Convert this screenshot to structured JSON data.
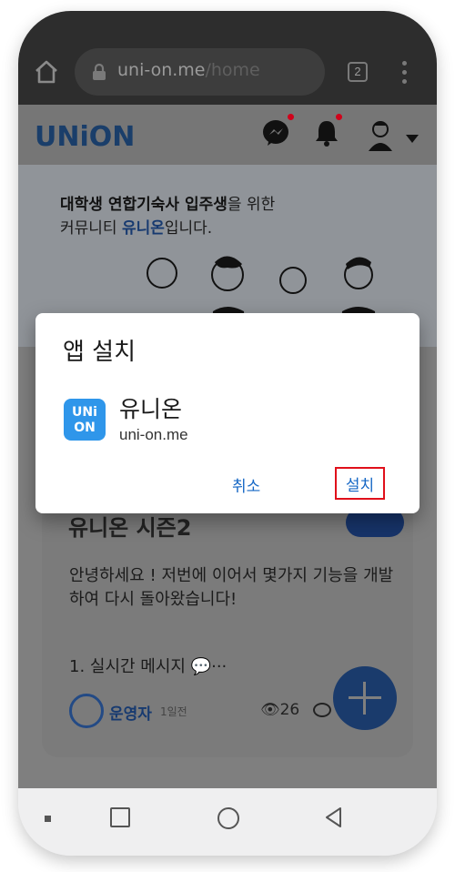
{
  "browser": {
    "url_host": "uni-on.me",
    "url_path": "/home",
    "tab_count": "2"
  },
  "site": {
    "logo": "UNiON",
    "hero_line1_bold": "대학생 연합기숙사 입주생",
    "hero_line1_rest": "을 위한",
    "hero_line2_pre": "커뮤니티 ",
    "hero_line2_brand": "유니온",
    "hero_line2_post": "입니다."
  },
  "post": {
    "title": "유니온 시즌2",
    "body": "안녕하세요 ! 저번에 이어서 몇가지 기능을 개발하여 다시 돌아왔습니다!",
    "list_item": "1. 실시간 메시지 💬···",
    "author": "운영자",
    "time": "1일전",
    "views": "26"
  },
  "dialog": {
    "title": "앱 설치",
    "app_icon_line1": "UNi",
    "app_icon_line2": "ON",
    "app_name": "유니온",
    "app_host": "uni-on.me",
    "cancel_label": "취소",
    "install_label": "설치"
  },
  "colors": {
    "accent": "#1567c5",
    "brand": "#173a70",
    "highlight_border": "#e0101b",
    "app_icon": "#2f96ea"
  }
}
